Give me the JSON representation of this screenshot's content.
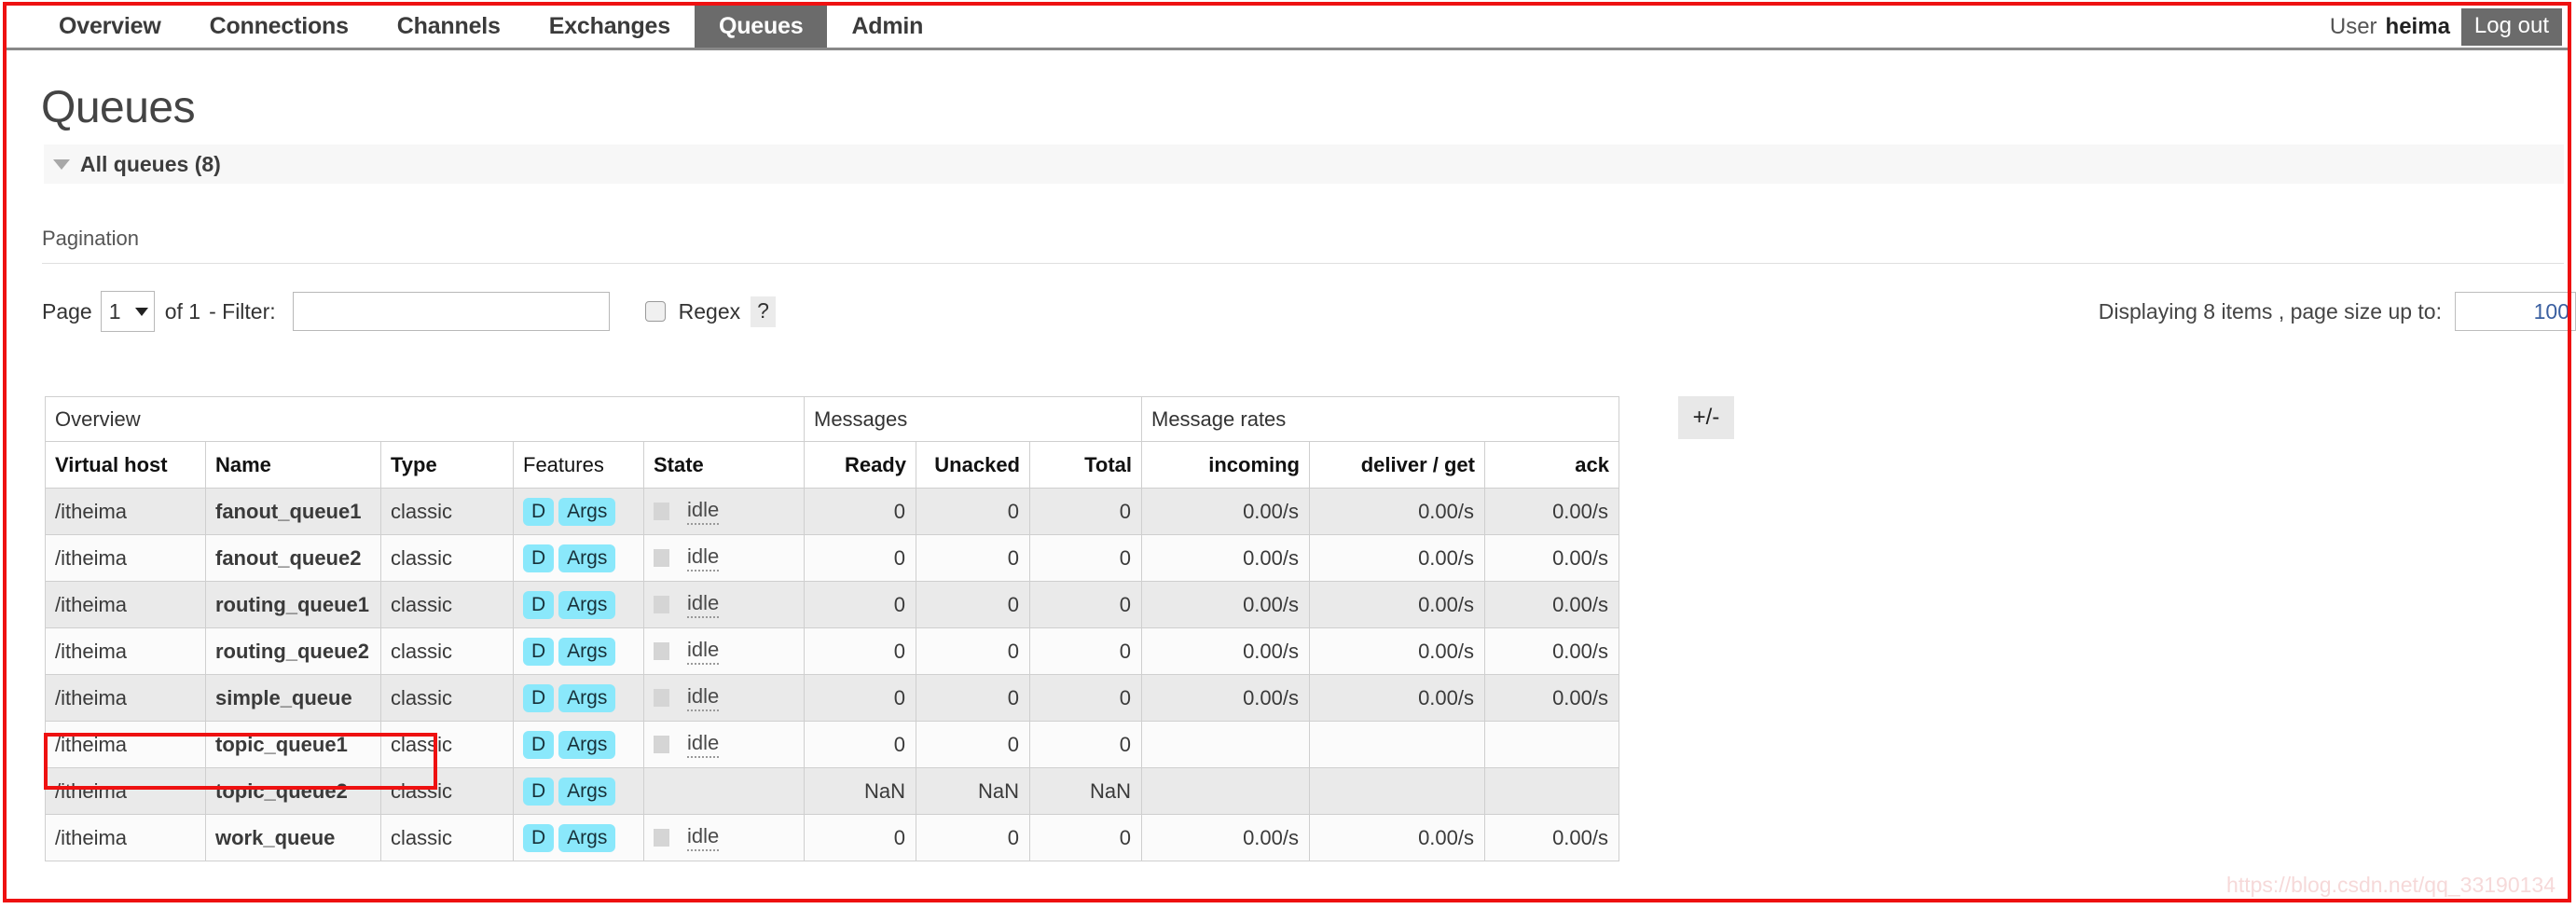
{
  "nav": {
    "tabs": [
      {
        "label": "Overview",
        "active": false
      },
      {
        "label": "Connections",
        "active": false
      },
      {
        "label": "Channels",
        "active": false
      },
      {
        "label": "Exchanges",
        "active": false
      },
      {
        "label": "Queues",
        "active": true
      },
      {
        "label": "Admin",
        "active": false
      }
    ],
    "user_prefix": "User",
    "user_name": "heima",
    "logout_label": "Log out"
  },
  "page": {
    "title": "Queues",
    "section_label": "All queues (8)",
    "collapse_icon": "triangle-down-icon"
  },
  "pagination": {
    "heading": "Pagination",
    "page_label": "Page",
    "page_value": "1",
    "of_label": "of 1",
    "filter_label": "- Filter:",
    "filter_value": "",
    "filter_placeholder": "",
    "regex_label": "Regex",
    "regex_checked": false,
    "help_label": "?",
    "displaying_text": "Displaying 8 items , page size up to:",
    "page_size_value": "100"
  },
  "table": {
    "group_headers": [
      {
        "label": "Overview",
        "span": 5
      },
      {
        "label": "Messages",
        "span": 3
      },
      {
        "label": "Message rates",
        "span": 3
      }
    ],
    "columns": [
      {
        "label": "Virtual host",
        "align": "left",
        "bold": true
      },
      {
        "label": "Name",
        "align": "left",
        "bold": true
      },
      {
        "label": "Type",
        "align": "left",
        "bold": true
      },
      {
        "label": "Features",
        "align": "left",
        "bold": false
      },
      {
        "label": "State",
        "align": "left",
        "bold": true
      },
      {
        "label": "Ready",
        "align": "right",
        "bold": true
      },
      {
        "label": "Unacked",
        "align": "right",
        "bold": true
      },
      {
        "label": "Total",
        "align": "right",
        "bold": true
      },
      {
        "label": "incoming",
        "align": "right",
        "bold": true
      },
      {
        "label": "deliver / get",
        "align": "right",
        "bold": true
      },
      {
        "label": "ack",
        "align": "right",
        "bold": true
      }
    ],
    "toggle_columns_label": "+/-",
    "rows": [
      {
        "vhost": "/itheima",
        "name": "fanout_queue1",
        "type": "classic",
        "features": [
          "D",
          "Args"
        ],
        "state": "idle",
        "has_state": true,
        "ready": "0",
        "unacked": "0",
        "total": "0",
        "incoming": "0.00/s",
        "deliver_get": "0.00/s",
        "ack": "0.00/s"
      },
      {
        "vhost": "/itheima",
        "name": "fanout_queue2",
        "type": "classic",
        "features": [
          "D",
          "Args"
        ],
        "state": "idle",
        "has_state": true,
        "ready": "0",
        "unacked": "0",
        "total": "0",
        "incoming": "0.00/s",
        "deliver_get": "0.00/s",
        "ack": "0.00/s"
      },
      {
        "vhost": "/itheima",
        "name": "routing_queue1",
        "type": "classic",
        "features": [
          "D",
          "Args"
        ],
        "state": "idle",
        "has_state": true,
        "ready": "0",
        "unacked": "0",
        "total": "0",
        "incoming": "0.00/s",
        "deliver_get": "0.00/s",
        "ack": "0.00/s"
      },
      {
        "vhost": "/itheima",
        "name": "routing_queue2",
        "type": "classic",
        "features": [
          "D",
          "Args"
        ],
        "state": "idle",
        "has_state": true,
        "ready": "0",
        "unacked": "0",
        "total": "0",
        "incoming": "0.00/s",
        "deliver_get": "0.00/s",
        "ack": "0.00/s"
      },
      {
        "vhost": "/itheima",
        "name": "simple_queue",
        "type": "classic",
        "features": [
          "D",
          "Args"
        ],
        "state": "idle",
        "has_state": true,
        "ready": "0",
        "unacked": "0",
        "total": "0",
        "incoming": "0.00/s",
        "deliver_get": "0.00/s",
        "ack": "0.00/s"
      },
      {
        "vhost": "/itheima",
        "name": "topic_queue1",
        "type": "classic",
        "features": [
          "D",
          "Args"
        ],
        "state": "idle",
        "has_state": true,
        "ready": "0",
        "unacked": "0",
        "total": "0",
        "incoming": "",
        "deliver_get": "",
        "ack": ""
      },
      {
        "vhost": "/itheima",
        "name": "topic_queue2",
        "type": "classic",
        "features": [
          "D",
          "Args"
        ],
        "state": "",
        "has_state": false,
        "ready": "NaN",
        "unacked": "NaN",
        "total": "NaN",
        "incoming": "",
        "deliver_get": "",
        "ack": ""
      },
      {
        "vhost": "/itheima",
        "name": "work_queue",
        "type": "classic",
        "features": [
          "D",
          "Args"
        ],
        "state": "idle",
        "has_state": true,
        "ready": "0",
        "unacked": "0",
        "total": "0",
        "incoming": "0.00/s",
        "deliver_get": "0.00/s",
        "ack": "0.00/s"
      }
    ]
  },
  "watermark": "https://blog.csdn.net/qq_33190134",
  "colors": {
    "annotation_red": "#ee1111",
    "active_tab_bg": "#6b6b6b",
    "feature_badge": "#8ae8fb",
    "row_odd": "#eaeaea",
    "row_even": "#fbfbfb"
  }
}
